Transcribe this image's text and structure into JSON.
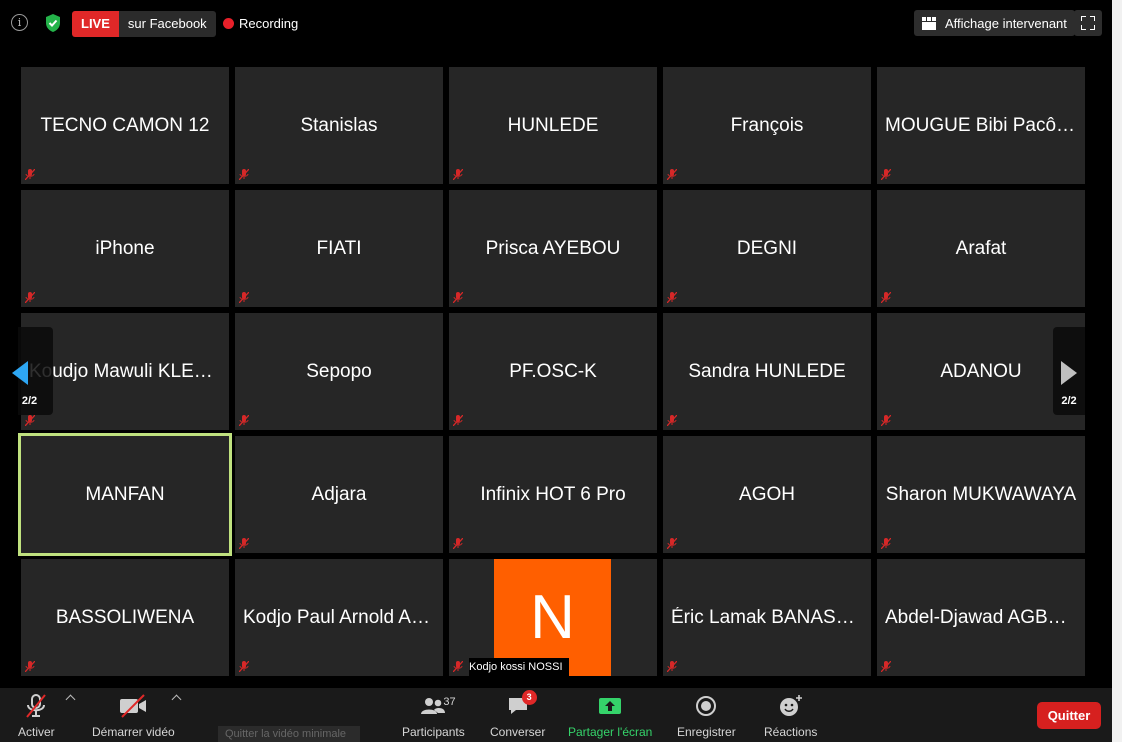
{
  "topbar": {
    "live_badge": "LIVE",
    "live_destination": "sur Facebook",
    "recording_label": "Recording",
    "view_label": "Affichage intervenant"
  },
  "participants": [
    {
      "name": "TECNO CAMON 12"
    },
    {
      "name": "Stanislas"
    },
    {
      "name": "HUNLEDE"
    },
    {
      "name": "François"
    },
    {
      "name": "MOUGUE Bibi Pacôme"
    },
    {
      "name": "iPhone"
    },
    {
      "name": "FIATI"
    },
    {
      "name": "Prisca AYEBOU"
    },
    {
      "name": "DEGNI"
    },
    {
      "name": "Arafat"
    },
    {
      "name": "Koudjo Mawuli KLEVOR"
    },
    {
      "name": "Sepopo"
    },
    {
      "name": "PF.OSC-K"
    },
    {
      "name": "Sandra HUNLEDE"
    },
    {
      "name": "ADANOU"
    },
    {
      "name": "MANFAN"
    },
    {
      "name": "Adjara"
    },
    {
      "name": "Infinix HOT 6 Pro"
    },
    {
      "name": "AGOH"
    },
    {
      "name": "Sharon MUKWAWAYA"
    },
    {
      "name": "BASSOLIWENA"
    },
    {
      "name": "Kodjo Paul Arnold AHO"
    },
    {
      "name": "Kodjo kossi NOSSI",
      "avatar_letter": "N"
    },
    {
      "name": "Éric Lamak BANASSIM"
    },
    {
      "name": "Abdel-Djawad AGBOKA"
    }
  ],
  "pager": {
    "left_label": "2/2",
    "right_label": "2/2"
  },
  "toolbar": {
    "mute_label": "Activer",
    "video_label": "Démarrer vidéo",
    "participants_label": "Participants",
    "participants_count": "37",
    "chat_label": "Converser",
    "chat_badge": "3",
    "share_label": "Partager l'écran",
    "record_label": "Enregistrer",
    "reactions_label": "Réactions",
    "quit_label": "Quitter",
    "tooltip": "Quitter la vidéo minimale"
  },
  "colors": {
    "live": "#e02828",
    "recording": "#e8202a",
    "active_speaker_border": "#c0e27f",
    "avatar": "#ff5f00",
    "share": "#35d36a",
    "quit": "#d6201f",
    "pager_arrow": "#2ea7f4"
  }
}
